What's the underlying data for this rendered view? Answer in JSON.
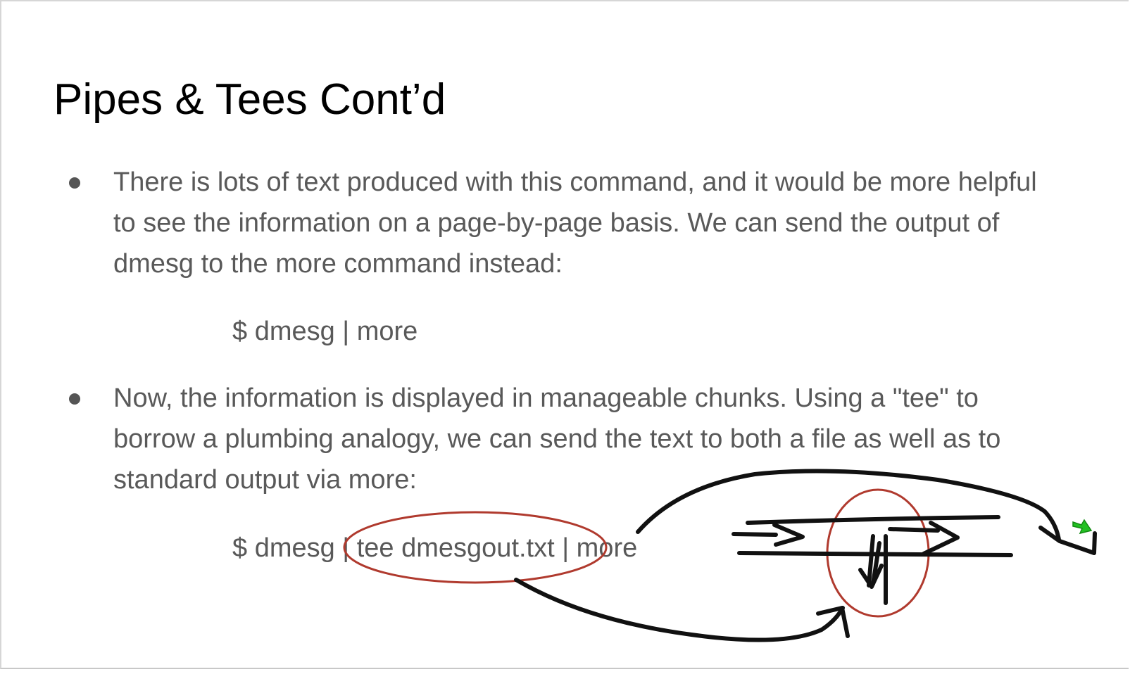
{
  "slide": {
    "title": "Pipes & Tees Cont’d",
    "bullets": [
      {
        "lines": [
          "There is lots of text produced with this command, and it would be more helpful",
          "to see the information on a page-by-page basis. We can send the output of",
          "dmesg to the more command instead:"
        ],
        "command": "$ dmesg | more"
      },
      {
        "lines": [
          "Now, the information is displayed in manageable chunks. Using a \"tee\" to",
          "borrow a plumbing analogy, we can send the text to both a file as well as to",
          "standard output via more:"
        ],
        "command": "$ dmesg | tee dmesgout.txt | more"
      }
    ]
  },
  "annotations": {
    "ink_color": "#111111",
    "circle_color": "#b03a2e",
    "cursor_color": "#22c022",
    "shapes": [
      "red-ellipse-around-tee-command",
      "red-circle-around-tee-junction",
      "pipe-tee-sketch",
      "curved-arrow-to-junction",
      "curved-arrow-over-pipe",
      "cursor-icon"
    ]
  }
}
